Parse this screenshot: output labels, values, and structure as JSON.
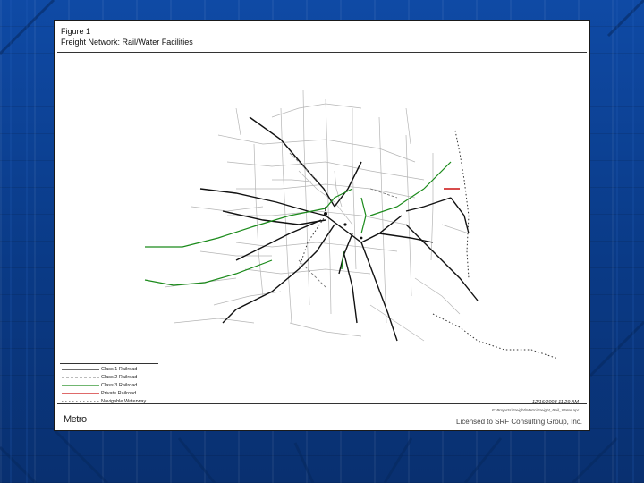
{
  "figure": {
    "title": "Figure 1",
    "subtitle": "Freight Network: Rail/Water Facilities"
  },
  "legend": {
    "items": [
      {
        "label": "Class 1 Railroad",
        "color": "#111111",
        "style": "solid-ticks"
      },
      {
        "label": "Class 2 Railroad",
        "color": "#777777",
        "style": "dashed"
      },
      {
        "label": "Class 3 Railroad",
        "color": "#1a8a1a",
        "style": "solid-ticks"
      },
      {
        "label": "Private Railroad",
        "color": "#cc1111",
        "style": "solid-ticks"
      },
      {
        "label": "Navigable Waterway",
        "color": "#333333",
        "style": "dotted"
      }
    ]
  },
  "footer": {
    "timestamp": "12/16/2003 11:29 AM",
    "filepath": "F:\\Projects\\Freight\\Metro\\Freight_Rail_Water.apr",
    "logo_text": "Metro",
    "license": "Licensed to SRF Consulting Group, Inc."
  },
  "colors": {
    "slide_background": "#0b3f8f",
    "class1": "#111111",
    "class2": "#777777",
    "class3": "#1a8a1a",
    "private": "#cc1111",
    "waterway": "#333333",
    "roads": "#b5b5b5"
  }
}
